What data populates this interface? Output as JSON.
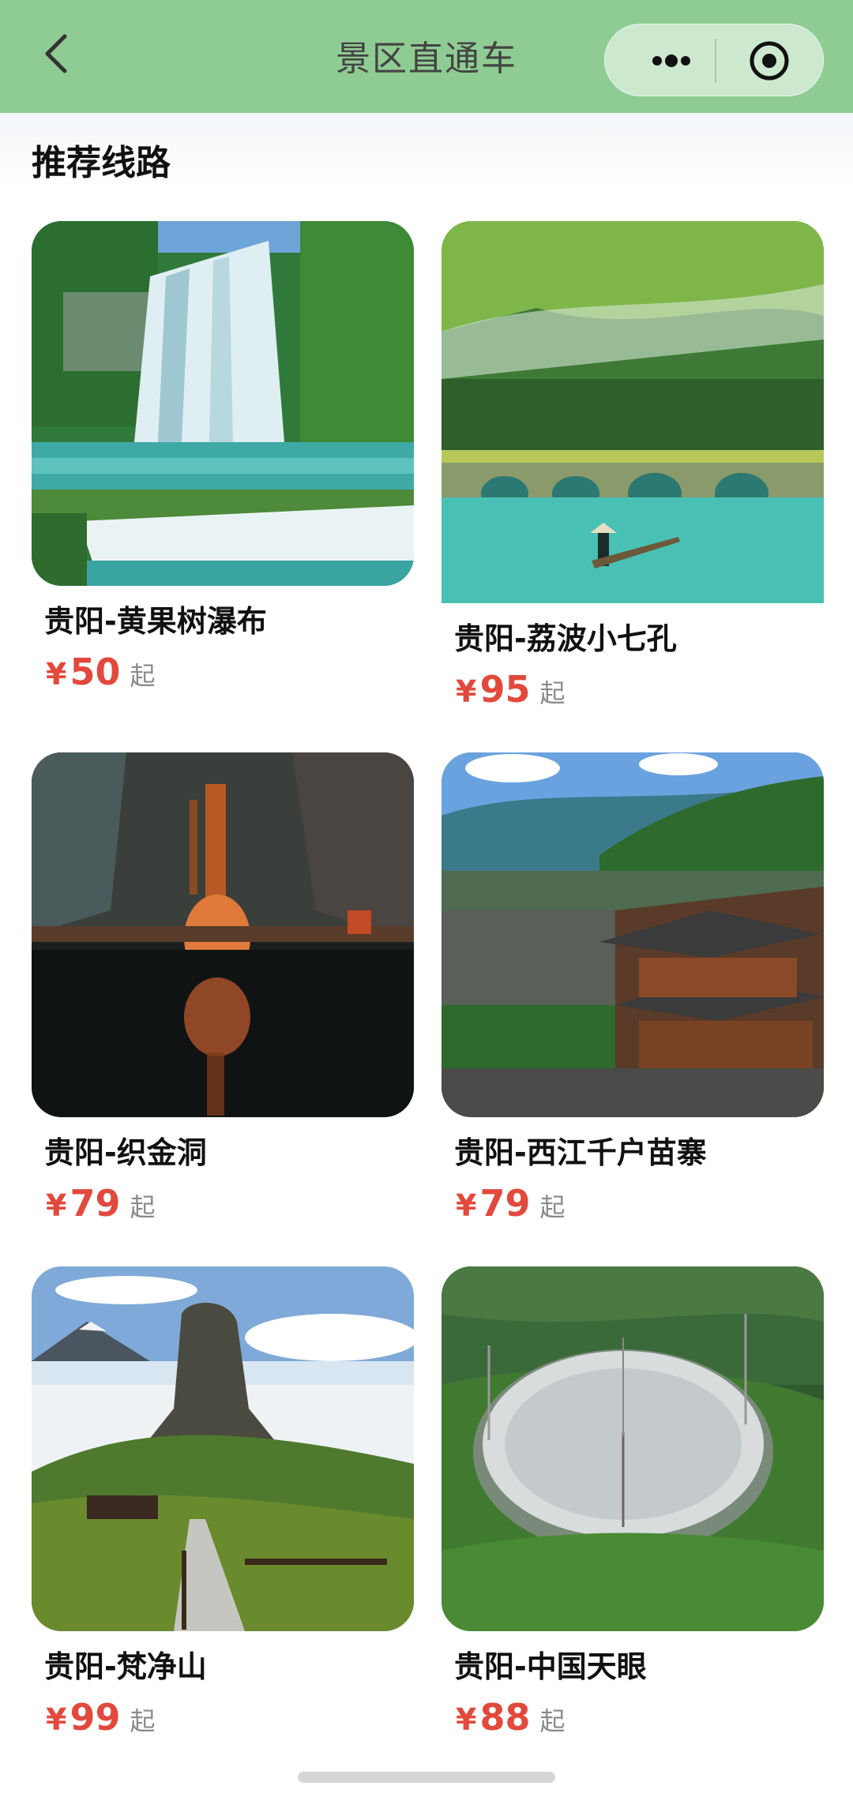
{
  "navbar": {
    "title": "景区直通车",
    "back_icon": "chevron-left-icon",
    "more_icon": "more-dots-icon",
    "close_icon": "target-circle-icon",
    "background": "#8fcc93"
  },
  "section": {
    "title": "推荐线路"
  },
  "routes": [
    {
      "name": "贵阳-黄果树瀑布",
      "currency": "¥",
      "price": "50",
      "unit": "起",
      "image": "waterfall"
    },
    {
      "name": "贵阳-荔波小七孔",
      "currency": "¥",
      "price": "95",
      "unit": "起",
      "image": "stone-bridge-lake"
    },
    {
      "name": "贵阳-织金洞",
      "currency": "¥",
      "price": "79",
      "unit": "起",
      "image": "cave"
    },
    {
      "name": "贵阳-西江千户苗寨",
      "currency": "¥",
      "price": "79",
      "unit": "起",
      "image": "miao-village"
    },
    {
      "name": "贵阳-梵净山",
      "currency": "¥",
      "price": "99",
      "unit": "起",
      "image": "mountain-peak"
    },
    {
      "name": "贵阳-中国天眼",
      "currency": "¥",
      "price": "88",
      "unit": "起",
      "image": "radio-telescope"
    }
  ],
  "colors": {
    "price": "#e2493c",
    "unit": "#8a8a8a"
  }
}
